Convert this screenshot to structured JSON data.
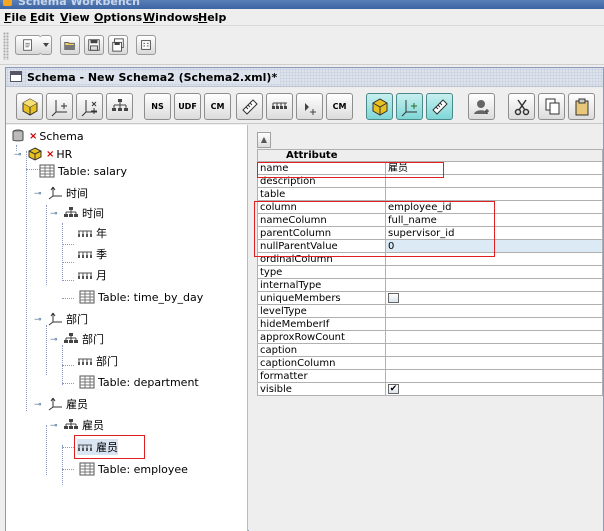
{
  "window": {
    "title": "Schema Workbench"
  },
  "menu": [
    {
      "label": "File",
      "mnemonic": "F",
      "rest": "ile"
    },
    {
      "label": "Edit",
      "mnemonic": "E",
      "rest": "dit"
    },
    {
      "label": "View",
      "mnemonic": "V",
      "rest": "iew"
    },
    {
      "label": "Options",
      "mnemonic": "O",
      "rest": "ptions"
    },
    {
      "label": "Windows",
      "mnemonic": "W",
      "rest": "indows"
    },
    {
      "label": "Help",
      "mnemonic": "H",
      "rest": "elp"
    }
  ],
  "toolbar_main": {
    "icons": [
      "new-icon",
      "dropdown-arrow-icon",
      "open-folder-icon",
      "save-icon",
      "save-as-icon",
      "preferences-icon"
    ]
  },
  "schema_window": {
    "title": "Schema - New Schema2 (Schema2.xml)*",
    "toolbar": {
      "ns_label": "NS",
      "udf_label": "UDF",
      "cm_label": "CM",
      "cm2_label": "CM"
    }
  },
  "tree": {
    "root": "Schema",
    "cube": "HR",
    "cube_table": "Table: salary",
    "dim_time": "时间",
    "hier_time": "时间",
    "level_year": "年",
    "level_quarter": "季",
    "level_month": "月",
    "time_table": "Table: time_by_day",
    "dim_dept": "部门",
    "hier_dept": "部门",
    "level_dept": "部门",
    "dept_table": "Table: department",
    "dim_emp": "雇员",
    "hier_emp": "雇员",
    "level_emp": "雇员",
    "emp_table": "Table: employee"
  },
  "properties": {
    "header": "Attribute",
    "rows": [
      {
        "key": "name",
        "value": "雇员"
      },
      {
        "key": "description",
        "value": ""
      },
      {
        "key": "table",
        "value": ""
      },
      {
        "key": "column",
        "value": "employee_id"
      },
      {
        "key": "nameColumn",
        "value": "full_name"
      },
      {
        "key": "parentColumn",
        "value": "supervisor_id"
      },
      {
        "key": "nullParentValue",
        "value": "0"
      },
      {
        "key": "ordinalColumn",
        "value": ""
      },
      {
        "key": "type",
        "value": ""
      },
      {
        "key": "internalType",
        "value": ""
      },
      {
        "key": "uniqueMembers",
        "value": ""
      },
      {
        "key": "levelType",
        "value": ""
      },
      {
        "key": "hideMemberIf",
        "value": ""
      },
      {
        "key": "approxRowCount",
        "value": ""
      },
      {
        "key": "caption",
        "value": ""
      },
      {
        "key": "captionColumn",
        "value": ""
      },
      {
        "key": "formatter",
        "value": ""
      },
      {
        "key": "visible",
        "value": ""
      }
    ],
    "visible_checkbox_mark": "✔"
  },
  "colors": {
    "highlight_border": "#e02020",
    "selected_value_bg": "#dbeaf5",
    "tree_line": "#8a9ac0"
  }
}
